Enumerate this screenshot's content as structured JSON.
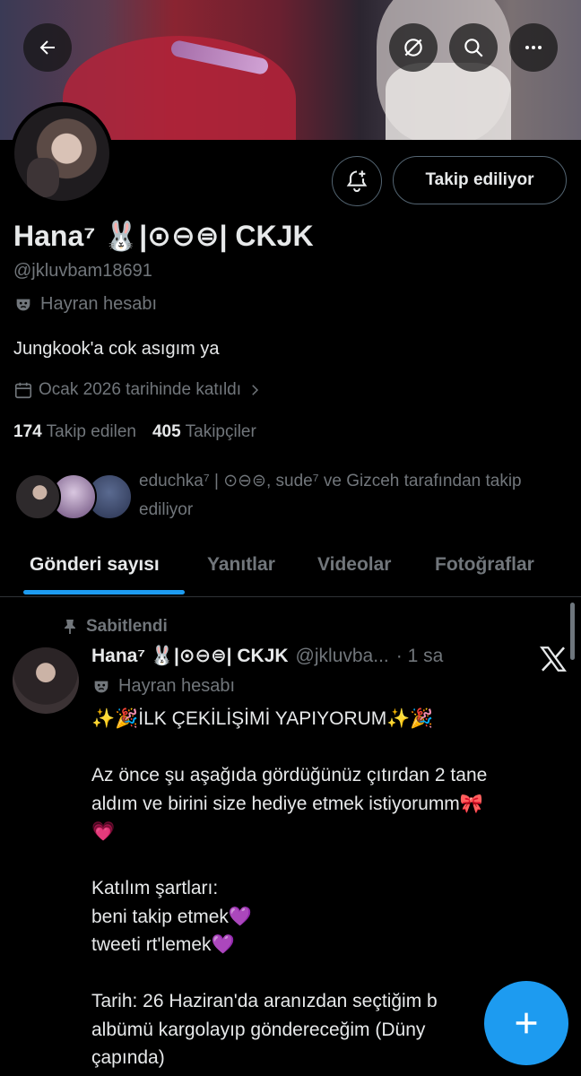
{
  "header": {
    "back_icon": "arrow-left-icon",
    "grok_icon": "slash-circle-icon",
    "search_icon": "search-icon",
    "more_icon": "more-horizontal-icon"
  },
  "profile": {
    "display_name": "Hana⁷ 🐰|⊙⊖⊜| CKJK",
    "handle": "@jkluvbam18691",
    "category": "Hayran hesabı",
    "bio": "Jungkook'a cok asıgım ya",
    "joined": "Ocak 2026 tarihinde katıldı",
    "following_count": "174",
    "following_label": "Takip edilen",
    "followers_count": "405",
    "followers_label": "Takipçiler",
    "follow_button": "Takip ediliyor",
    "mutuals_text": "educhka⁷ | ⊙⊖⊜, sude⁷ ve Gizceh tarafından takip ediliyor"
  },
  "tabs": [
    {
      "label": "Gönderi sayısı",
      "active": true
    },
    {
      "label": "Yanıtlar",
      "active": false
    },
    {
      "label": "Videolar",
      "active": false
    },
    {
      "label": "Fotoğraflar",
      "active": false
    }
  ],
  "post": {
    "pinned_label": "Sabitlendi",
    "author_name": "Hana⁷ 🐰|⊙⊖⊜| CKJK",
    "author_handle": "@jkluvba...",
    "time": "· 1 sa",
    "author_category": "Hayran hesabı",
    "lines": [
      "✨🎉İLK ÇEKİLİŞİMİ YAPIYORUM✨🎉",
      "",
      "Az önce şu aşağıda gördüğünüz çıtırdan 2 tane",
      "aldım ve birini size hediye etmek istiyorumm🎀",
      "💗",
      "",
      "Katılım şartları:",
      "beni takip etmek💜",
      "tweeti rt'lemek💜",
      "",
      "Tarih: 26 Haziran'da aranızdan seçtiğim b",
      "albümü kargolayıp göndereceğim (Düny",
      "çapında)"
    ]
  },
  "colors": {
    "accent": "#1d9bf0",
    "text_primary": "#e7e9ea",
    "text_secondary": "#71767b",
    "background": "#000000",
    "border": "#2f3336"
  }
}
